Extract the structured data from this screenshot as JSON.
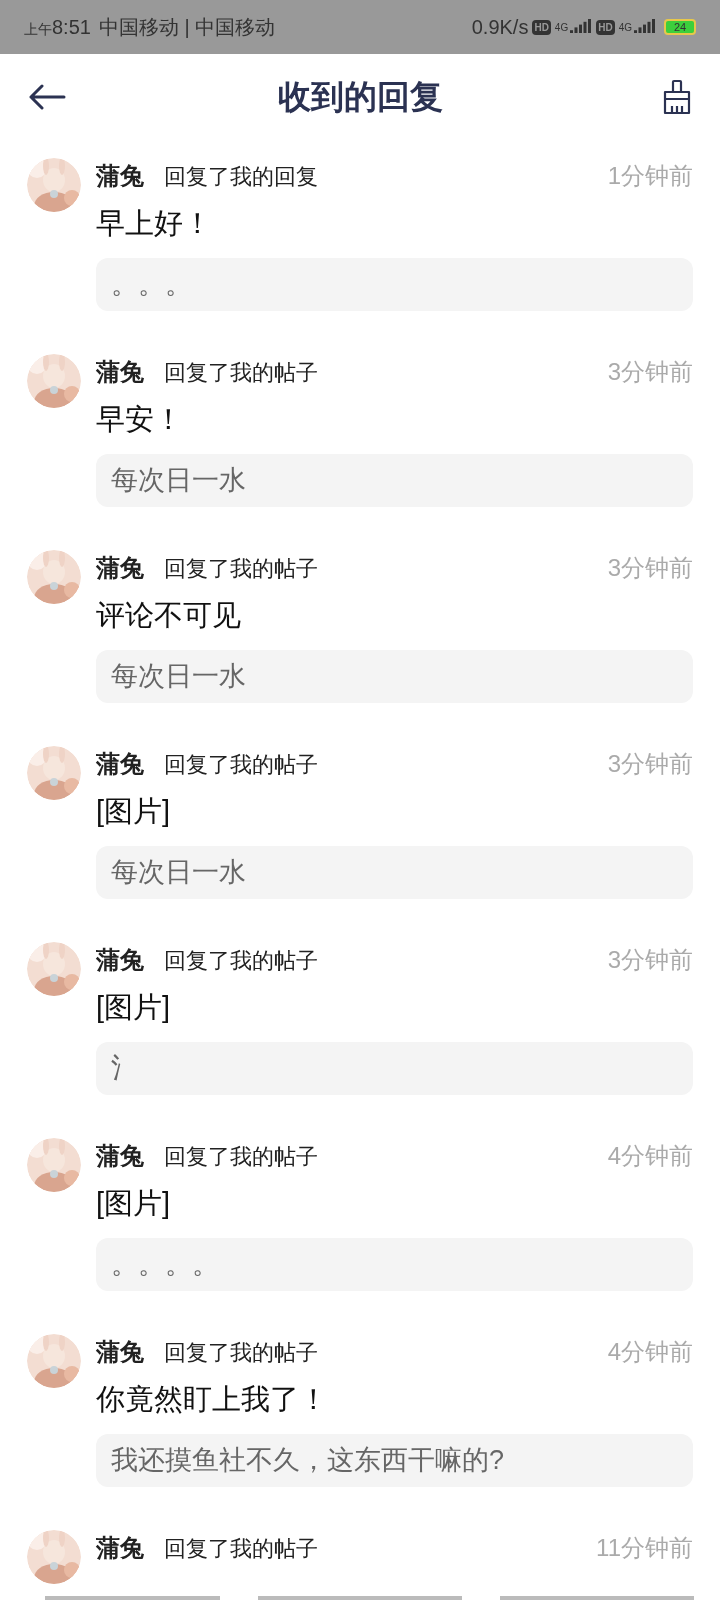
{
  "status_bar": {
    "period": "上午",
    "time": "8:51",
    "carriers": "中国移动 | 中国移动",
    "speed": "0.9K/s",
    "sim1_hd": "HD",
    "sim1_net": "4G",
    "sim2_hd": "HD",
    "sim2_net": "4G",
    "battery": "24"
  },
  "header": {
    "title": "收到的回复"
  },
  "replies": [
    {
      "user": "蒲兔",
      "action": "回复了我的回复",
      "time": "1分钟前",
      "text": "早上好！",
      "quote": "。。。"
    },
    {
      "user": "蒲兔",
      "action": "回复了我的帖子",
      "time": "3分钟前",
      "text": "早安！",
      "quote": "每次日一水"
    },
    {
      "user": "蒲兔",
      "action": "回复了我的帖子",
      "time": "3分钟前",
      "text": "评论不可见",
      "quote": "每次日一水"
    },
    {
      "user": "蒲兔",
      "action": "回复了我的帖子",
      "time": "3分钟前",
      "text": "[图片]",
      "quote": "每次日一水"
    },
    {
      "user": "蒲兔",
      "action": "回复了我的帖子",
      "time": "3分钟前",
      "text": "[图片]",
      "quote": "氵"
    },
    {
      "user": "蒲兔",
      "action": "回复了我的帖子",
      "time": "4分钟前",
      "text": "[图片]",
      "quote": "。。。。"
    },
    {
      "user": "蒲兔",
      "action": "回复了我的帖子",
      "time": "4分钟前",
      "text": "你竟然盯上我了！",
      "quote": "我还摸鱼社不久，这东西干嘛的?"
    },
    {
      "user": "蒲兔",
      "action": "回复了我的帖子",
      "time": "11分钟前"
    }
  ]
}
